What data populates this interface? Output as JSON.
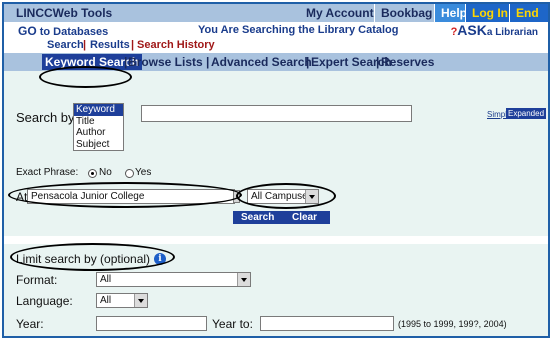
{
  "topbar": {
    "title": "LINCCWeb Tools",
    "my_account": "My Account",
    "bookbag": "Bookbag",
    "help": "Help",
    "login": "Log In",
    "end_session": "End Session"
  },
  "subbar": {
    "go": "GO",
    "to_databases": "to Databases",
    "searching": "You Are Searching the Library Catalog",
    "ask_prefix": "?",
    "ask": "ASK",
    "ask_suffix": "a Librarian"
  },
  "tabs": {
    "search": "Search",
    "results": "Results",
    "history": "Search History"
  },
  "nav": {
    "keyword": "Keyword Search",
    "browse": "Browse Lists",
    "advanced": "Advanced Search",
    "expert": "Expert Search",
    "reserves": "Reserves"
  },
  "form": {
    "search_by_label": "Search by:",
    "search_by_options": [
      "Keyword",
      "Title",
      "Author",
      "Subject"
    ],
    "search_value": "",
    "simple": "Simple",
    "expanded": "Expanded",
    "exact_phrase_label": "Exact Phrase:",
    "no": "No",
    "yes": "Yes",
    "at_label": "At:",
    "location": "Pensacola Junior College",
    "campuses": "All Campuses",
    "search_btn": "Search",
    "clear_btn": "Clear"
  },
  "limit": {
    "label": "Limit search by (optional)",
    "format_label": "Format:",
    "format_value": "All",
    "language_label": "Language:",
    "language_value": "All",
    "year_label": "Year:",
    "year_to_label": "Year to:",
    "year_hint": "(1995 to 1999, 199?, 2004)"
  },
  "colors": {
    "bar": "#a9c2de",
    "accent": "#1e3f9a",
    "panel": "#e9f4f2"
  }
}
